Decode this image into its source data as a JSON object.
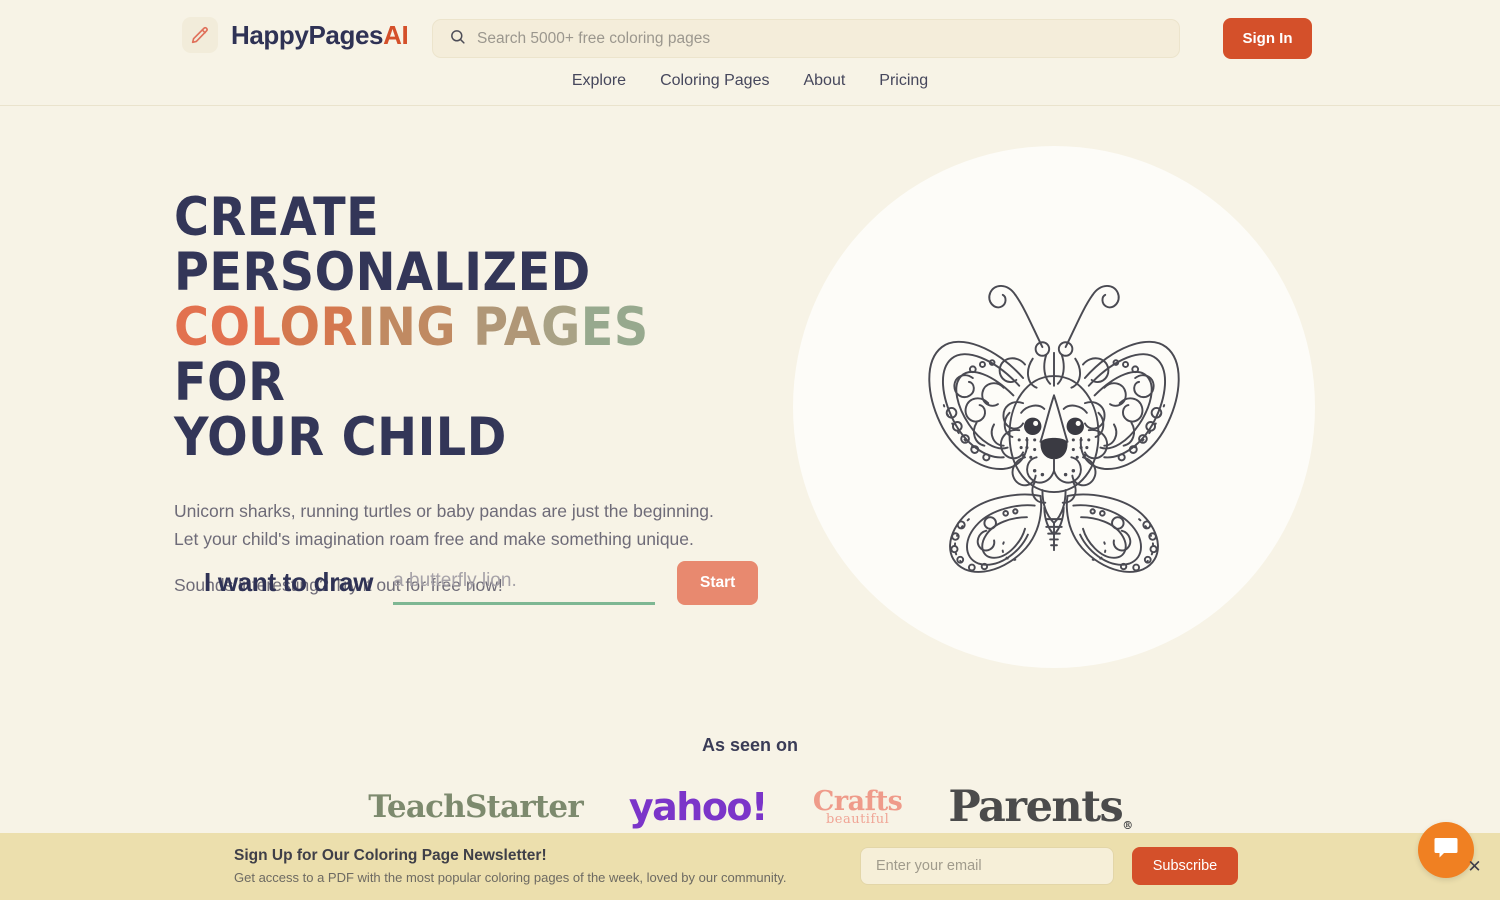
{
  "header": {
    "brand": {
      "name_dark": "HappyPages",
      "name_accent": "AI",
      "icon": "pencil-icon"
    },
    "search": {
      "placeholder": "Search 5000+ free coloring pages",
      "value": "",
      "icon": "search-icon"
    },
    "signin_label": "Sign In",
    "nav": [
      {
        "label": "Explore"
      },
      {
        "label": "Coloring Pages"
      },
      {
        "label": "About"
      },
      {
        "label": "Pricing"
      }
    ]
  },
  "hero": {
    "headline": {
      "line1": "Create Personalized",
      "w1": "Col",
      "w2": "or",
      "w3": "ing",
      "w4": " Pa",
      "w5": "g",
      "w6": "es",
      "line2_tail": " for",
      "line3": "Your Child"
    },
    "lede": "Unicorn sharks, running turtles or baby pandas are just the beginning. Let your child's imagination roam free and make something unique.",
    "lede2": "Sounds interesting? Try it out for free now!",
    "prompt_label": "I want to draw",
    "prompt_placeholder": "a butterfly lion.",
    "prompt_value": "",
    "start_label": "Start",
    "illustration": "butterfly-lion-coloring-page"
  },
  "as_seen_on": {
    "title": "As seen on",
    "logos": [
      {
        "name": "TeachStarter",
        "color": "#7d8a6e"
      },
      {
        "name": "yahoo!",
        "color": "#7b35c9"
      },
      {
        "name": "Crafts",
        "name2": "beautiful",
        "color": "#ef9b8a"
      },
      {
        "name": "Parents",
        "color": "#4b4b4b"
      }
    ]
  },
  "newsletter": {
    "title": "Sign Up for Our Coloring Page Newsletter!",
    "subtitle": "Get access to a PDF with the most popular coloring pages of the week, loved by our community.",
    "email_placeholder": "Enter your email",
    "email_value": "",
    "subscribe_label": "Subscribe"
  },
  "chat": {
    "icon": "chat-bubble-icon",
    "close_label": "✕"
  },
  "colors": {
    "page_bg": "#f7f3e6",
    "brand_dark": "#2f3255",
    "accent_red": "#d4502a",
    "accent_salmon": "#e8896f",
    "accent_green": "#7eb793",
    "newsletter_bg": "#ecdfad",
    "chat_orange": "#f08022"
  }
}
